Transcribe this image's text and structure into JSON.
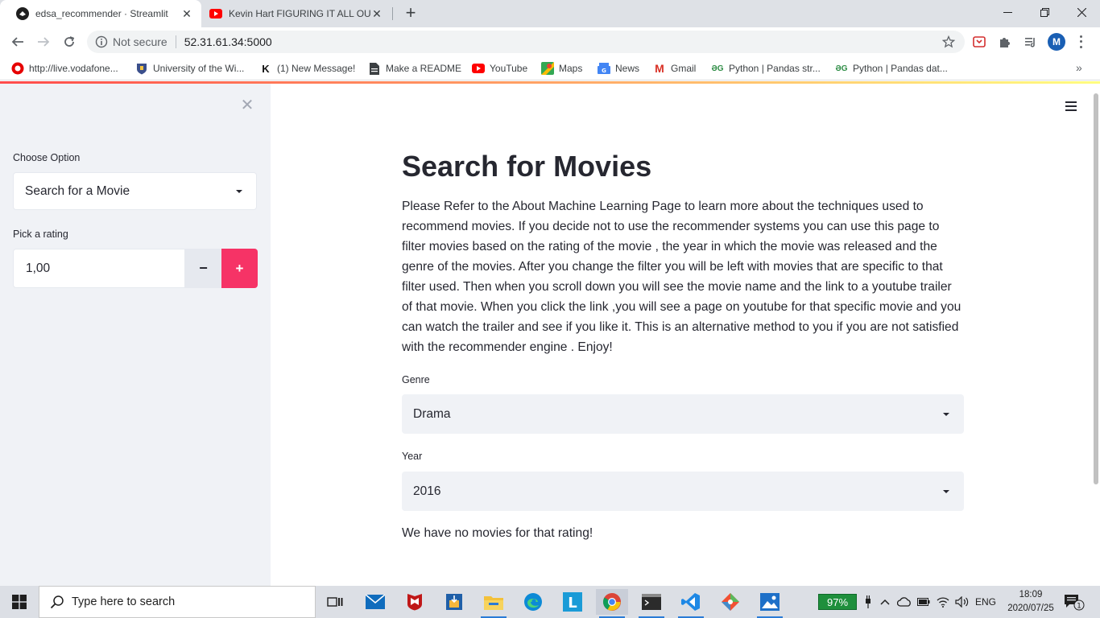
{
  "browser": {
    "tabs": [
      {
        "title": "edsa_recommender · Streamlit",
        "favicon": "streamlit-icon"
      },
      {
        "title": "Kevin Hart FIGURING IT ALL OUT",
        "favicon": "youtube-icon"
      }
    ],
    "security_text": "Not secure",
    "url": "52.31.61.34:5000",
    "profile_initial": "M",
    "bookmarks": [
      {
        "label": "http://live.vodafone...",
        "icon": "vodafone-icon"
      },
      {
        "label": "University of the Wi...",
        "icon": "university-icon"
      },
      {
        "label": "(1) New Message!",
        "icon": "k-icon",
        "glyph": "K"
      },
      {
        "label": "Make a README",
        "icon": "document-icon"
      },
      {
        "label": "YouTube",
        "icon": "youtube-icon"
      },
      {
        "label": "Maps",
        "icon": "maps-icon"
      },
      {
        "label": "News",
        "icon": "news-icon"
      },
      {
        "label": "Gmail",
        "icon": "gmail-icon",
        "glyph": "M"
      },
      {
        "label": "Python | Pandas str...",
        "icon": "gfg-icon",
        "glyph": "ƏG"
      },
      {
        "label": "Python | Pandas dat...",
        "icon": "gfg-icon",
        "glyph": "ƏG"
      }
    ],
    "bookmarks_more": "»"
  },
  "sidebar": {
    "choose_label": "Choose Option",
    "choose_value": "Search for a Movie",
    "rating_label": "Pick a rating",
    "rating_value": "1,00",
    "minus_label": "−",
    "plus_label": "+"
  },
  "main": {
    "title": "Search for Movies",
    "description": "Please Refer to the About Machine Learning Page to learn more about the techniques used to recommend movies. If you decide not to use the recommender systems you can use this page to filter movies based on the rating of the movie , the year in which the movie was released and the genre of the movies. After you change the filter you will be left with movies that are specific to that filter used. Then when you scroll down you will see the movie name and the link to a youtube trailer of that movie. When you click the link ,you will see a page on youtube for that specific movie and you can watch the trailer and see if you like it. This is an alternative method to you if you are not satisfied with the recommender engine . Enjoy!",
    "genre_label": "Genre",
    "genre_value": "Drama",
    "year_label": "Year",
    "year_value": "2016",
    "result_message": "We have no movies for that rating!"
  },
  "taskbar": {
    "search_placeholder": "Type here to search",
    "battery_percent": "97%",
    "language": "ENG",
    "time": "18:09",
    "date": "2020/07/25",
    "notification_count": "1"
  },
  "colors": {
    "streamlit_primary": "#f63366",
    "sidebar_bg": "#f0f2f6",
    "text": "#262730"
  }
}
